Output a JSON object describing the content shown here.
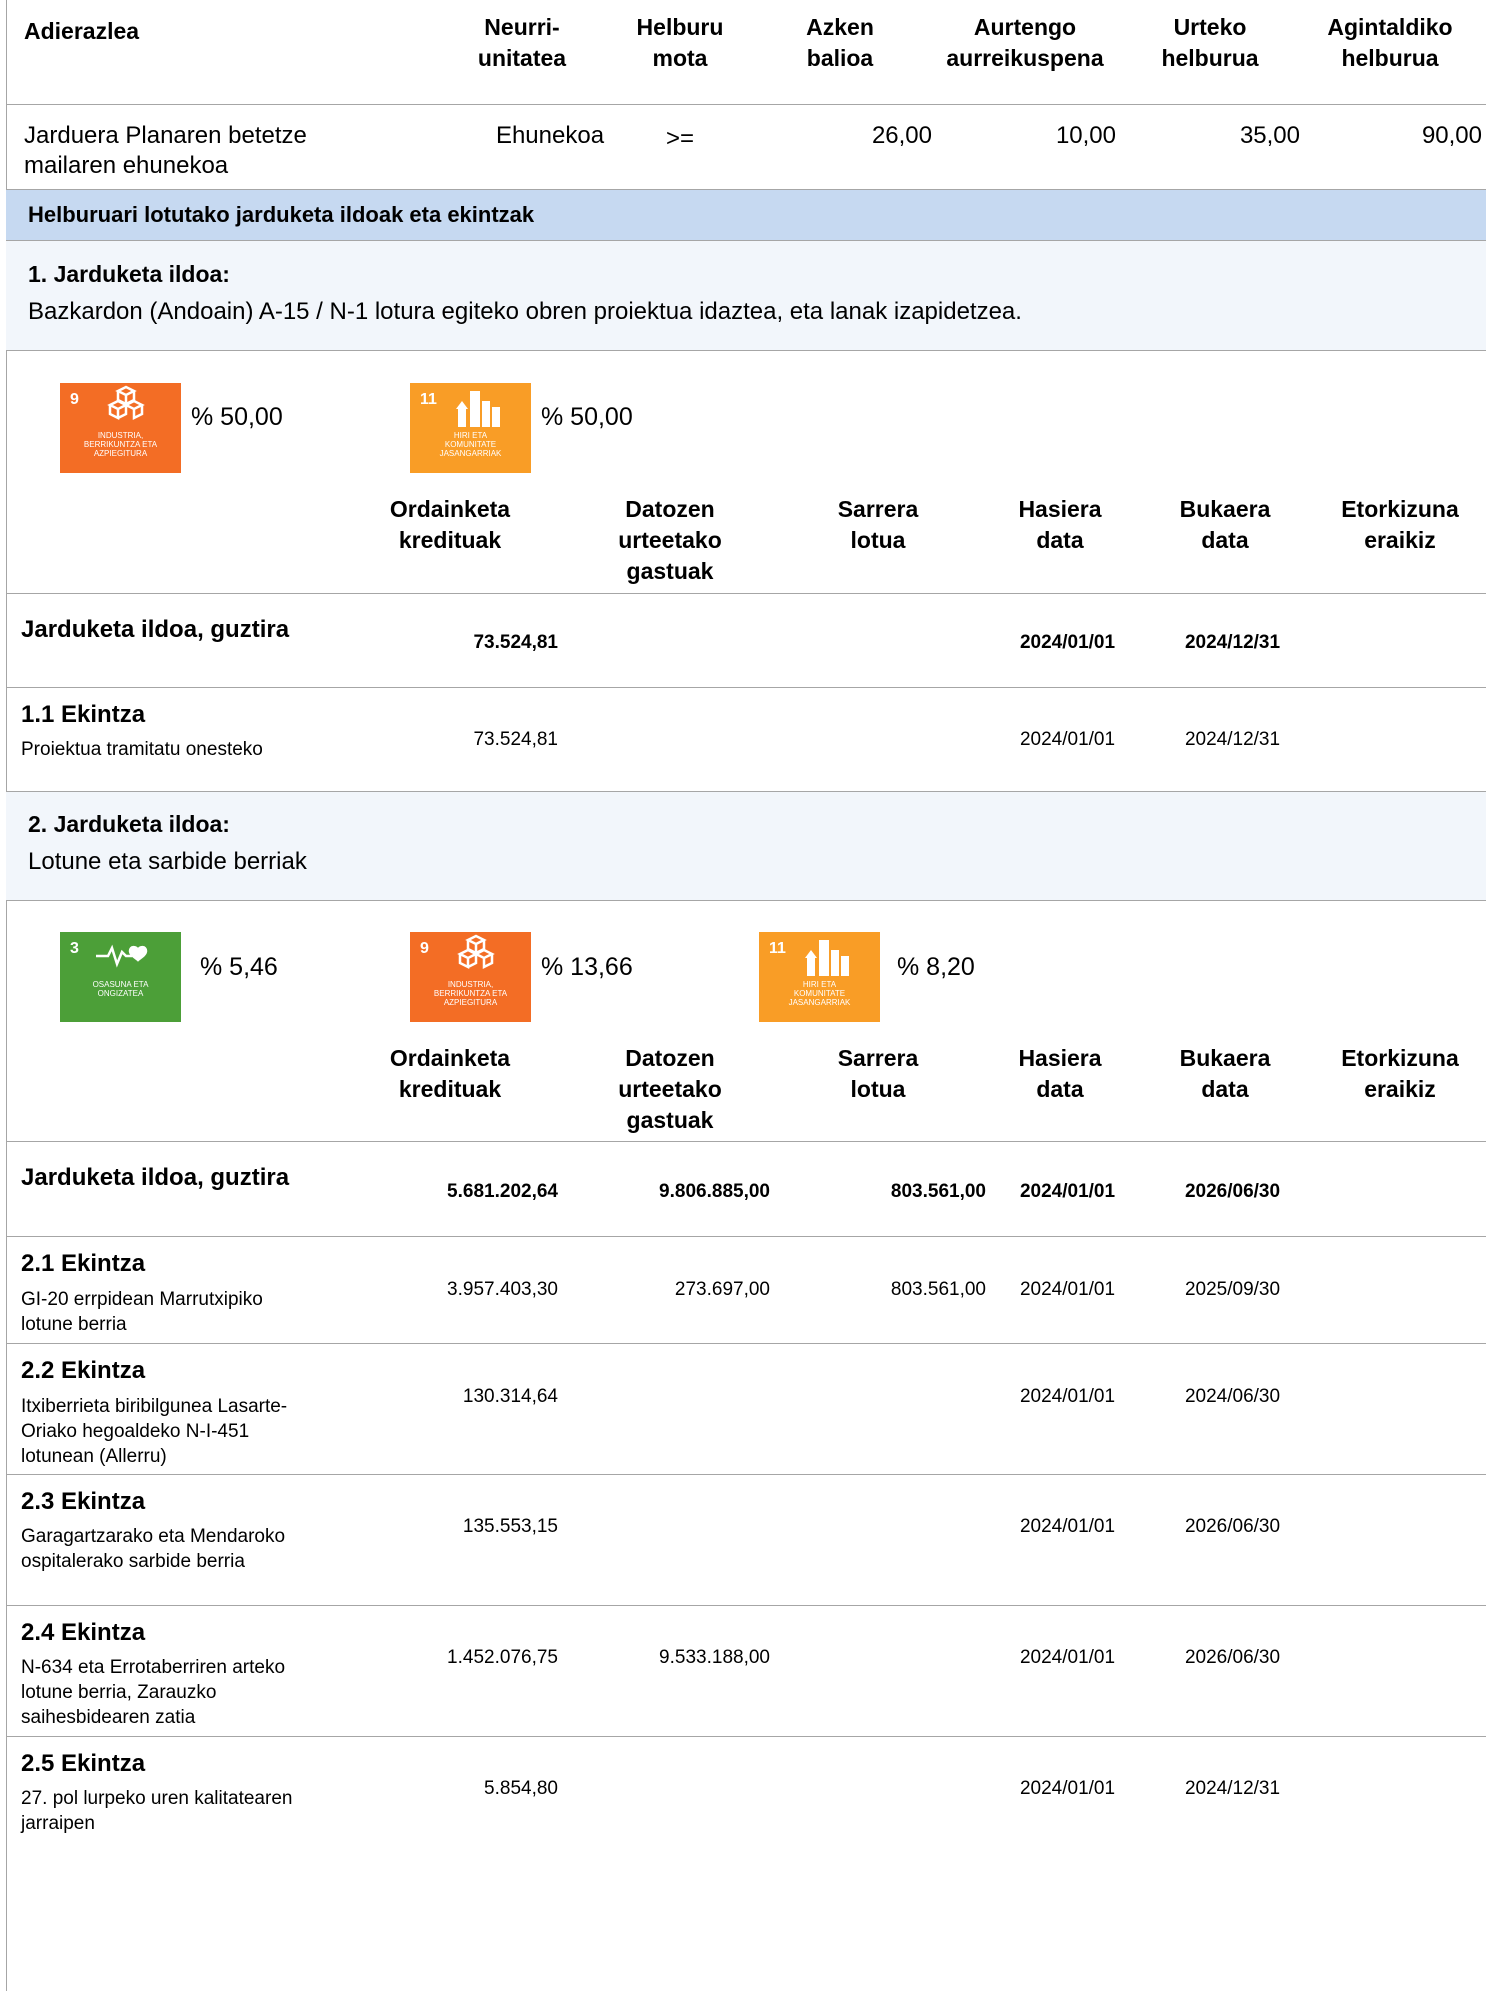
{
  "indicator_header": {
    "adierazlea": "Adierazlea",
    "neurri": "Neurri-\nunitatea",
    "helburu": "Helburu\nmota",
    "azken": "Azken\nbalioa",
    "aurtengo": "Aurtengo\naurreikuspena",
    "urteko": "Urteko\nhelburua",
    "agintaldiko": "Agintaldiko\nhelburua"
  },
  "indicator_row": {
    "name": "Jarduera Planaren betetze\nmailaren ehunekoa",
    "unit": "Ehunekoa",
    "type": ">=",
    "last_value": "26,00",
    "forecast": "10,00",
    "annual_goal": "35,00",
    "term_goal": "90,00"
  },
  "section_title": "Helburuari lotutako jarduketa ildoak eta ekintzak",
  "lines_header": {
    "ordainketa": "Ordainketa\nkredituak",
    "datozen": "Datozen\nurteetako\ngastuak",
    "sarrera": "Sarrera\nlotua",
    "hasiera": "Hasiera\ndata",
    "bukaera": "Bukaera\ndata",
    "etorkizuna": "Etorkizuna\neraikiz"
  },
  "line1": {
    "title": "1. Jarduketa ildoa:",
    "description": "Bazkardon (Andoain) A-15 / N-1 lotura egiteko obren proiektua idaztea, eta lanak izapidetzea.",
    "sdgs": [
      {
        "icon": "sdg-9-industry-icon",
        "number": "9",
        "caption": "INDUSTRIA,\nBERRIKUNTZA ETA\nAZPIEGITURA",
        "color": "#f36d25",
        "percent": "% 50,00"
      },
      {
        "icon": "sdg-11-cities-icon",
        "number": "11",
        "caption": "HIRI ETA\nKOMUNITATE\nJASANGARRIAK",
        "color": "#f99d26",
        "percent": "% 50,00"
      }
    ],
    "total": {
      "label": "Jarduketa ildoa, guztira",
      "ordainketa": "73.524,81",
      "datozen": "",
      "sarrera": "",
      "hasiera": "2024/01/01",
      "bukaera": "2024/12/31"
    },
    "actions": [
      {
        "title": "1.1 Ekintza",
        "desc": "Proiektua tramitatu onesteko",
        "ordainketa": "73.524,81",
        "datozen": "",
        "sarrera": "",
        "hasiera": "2024/01/01",
        "bukaera": "2024/12/31"
      }
    ]
  },
  "line2": {
    "title": "2. Jarduketa ildoa:",
    "description": "Lotune eta sarbide berriak",
    "sdgs": [
      {
        "icon": "sdg-3-health-icon",
        "number": "3",
        "caption": "OSASUNA ETA\nONGIZATEA",
        "color": "#4c9f38",
        "percent": "% 5,46"
      },
      {
        "icon": "sdg-9-industry-icon",
        "number": "9",
        "caption": "INDUSTRIA,\nBERRIKUNTZA ETA\nAZPIEGITURA",
        "color": "#f36d25",
        "percent": "% 13,66"
      },
      {
        "icon": "sdg-11-cities-icon",
        "number": "11",
        "caption": "HIRI ETA\nKOMUNITATE\nJASANGARRIAK",
        "color": "#f99d26",
        "percent": "% 8,20"
      }
    ],
    "total": {
      "label": "Jarduketa ildoa, guztira",
      "ordainketa": "5.681.202,64",
      "datozen": "9.806.885,00",
      "sarrera": "803.561,00",
      "hasiera": "2024/01/01",
      "bukaera": "2026/06/30"
    },
    "actions": [
      {
        "title": "2.1 Ekintza",
        "desc": "GI-20 errpidean Marrutxipiko\nlotune berria",
        "ordainketa": "3.957.403,30",
        "datozen": "273.697,00",
        "sarrera": "803.561,00",
        "hasiera": "2024/01/01",
        "bukaera": "2025/09/30"
      },
      {
        "title": "2.2 Ekintza",
        "desc": "Itxiberrieta biribilgunea Lasarte-\nOriako hegoaldeko N-I-451\nlotunean (Allerru)",
        "ordainketa": "130.314,64",
        "datozen": "",
        "sarrera": "",
        "hasiera": "2024/01/01",
        "bukaera": "2024/06/30"
      },
      {
        "title": "2.3 Ekintza",
        "desc": "Garagartzarako eta Mendaroko\nospitalerako sarbide berria",
        "ordainketa": "135.553,15",
        "datozen": "",
        "sarrera": "",
        "hasiera": "2024/01/01",
        "bukaera": "2026/06/30"
      },
      {
        "title": "2.4 Ekintza",
        "desc": "N-634 eta Errotaberriren arteko\nlotune berria, Zarauzko\nsaihesbidearen zatia",
        "ordainketa": "1.452.076,75",
        "datozen": "9.533.188,00",
        "sarrera": "",
        "hasiera": "2024/01/01",
        "bukaera": "2026/06/30"
      },
      {
        "title": "2.5 Ekintza",
        "desc": "27. pol lurpeko uren kalitatearen\njarraipen",
        "ordainketa": "5.854,80",
        "datozen": "",
        "sarrera": "",
        "hasiera": "2024/01/01",
        "bukaera": "2024/12/31"
      }
    ]
  }
}
